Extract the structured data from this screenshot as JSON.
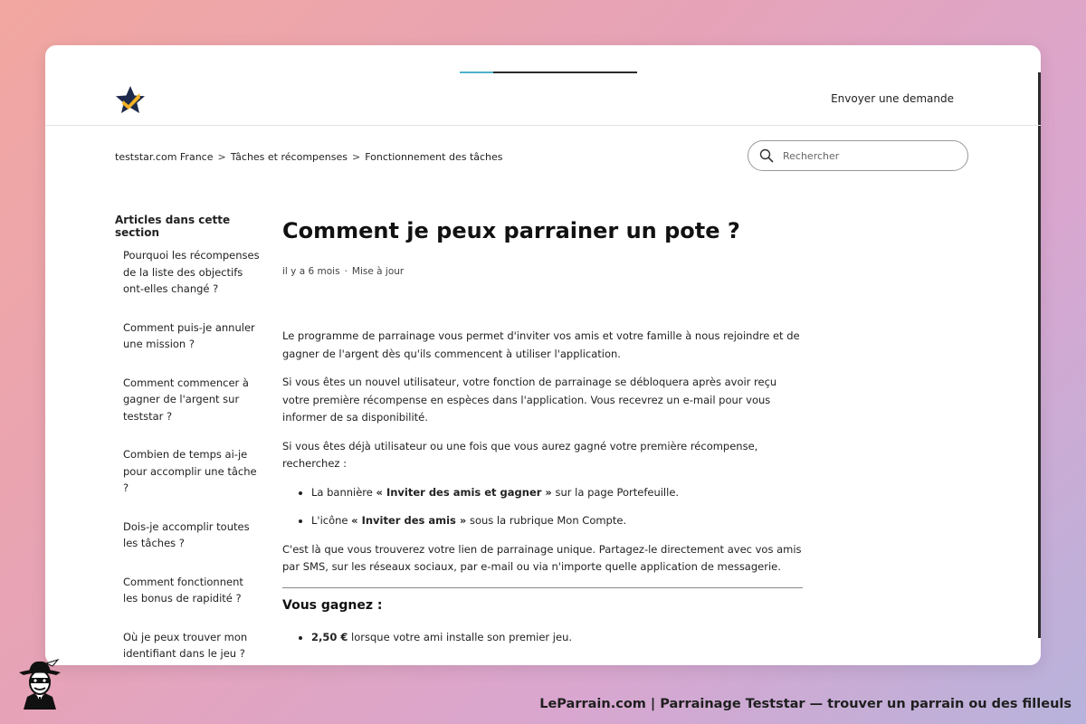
{
  "header": {
    "logo_name": "teststar-star-logo",
    "submit_request": "Envoyer une demande",
    "scroll_progress": 0.19
  },
  "breadcrumb": {
    "items": [
      "teststar.com France",
      "Tâches et récompenses",
      "Fonctionnement des tâches"
    ],
    "separator": ">"
  },
  "search": {
    "placeholder": "Rechercher",
    "value": ""
  },
  "sidebar": {
    "title": "Articles dans cette section",
    "items": [
      "Pourquoi les récompenses de la liste des objectifs ont-elles changé ?",
      "Comment puis-je annuler une mission ?",
      "Comment commencer à gagner de l'argent sur teststar ?",
      "Combien de temps ai-je pour accomplir une tâche ?",
      "Dois-je accomplir toutes les tâches ?",
      "Comment fonctionnent les bonus de rapidité ?",
      "Où je peux trouver mon identifiant dans le jeu ?"
    ]
  },
  "article": {
    "title": "Comment je peux parrainer un pote ?",
    "meta_time": "il y a 6 mois",
    "meta_separator": "·",
    "meta_update": "Mise à jour",
    "p1": "Le programme de parrainage vous permet d'inviter vos amis et votre famille à nous rejoindre et de gagner de l'argent dès qu'ils commencent à utiliser l'application.",
    "p2": "Si vous êtes un nouvel utilisateur, votre fonction de parrainage se débloquera après avoir reçu votre première récompense en espèces dans l'application. Vous recevrez un e-mail pour vous informer de sa disponibilité.",
    "p3": "Si vous êtes déjà utilisateur ou une fois que vous aurez gagné votre première récompense, recherchez :",
    "bullet1_pre": "La bannière ",
    "bullet1_bold": "« Inviter des amis et gagner »",
    "bullet1_post": " sur la page Portefeuille.",
    "bullet2_pre": "L'icône ",
    "bullet2_bold": "« Inviter des amis »",
    "bullet2_post": " sous la rubrique Mon Compte.",
    "p4": "C'est là que vous trouverez votre lien de parrainage unique. Partagez-le directement avec vos amis par SMS, sur les réseaux sociaux, par e-mail ou via n'importe quelle application de messagerie.",
    "section_title": "Vous gagnez :",
    "gain1_bold": "2,50 €",
    "gain1_post": " lorsque votre ami installe son premier jeu."
  },
  "footer": {
    "caption": "LeParrain.com | Parrainage Teststar — trouver un parrain ou des filleuls",
    "mascot_name": "masked-agent-mascot"
  },
  "colors": {
    "background_start": "#f2a7a0",
    "background_end": "#b7b3dc",
    "logo_dark": "#1e2a4a",
    "logo_accent": "#f5b324",
    "progress_accent": "#4fb3c9"
  }
}
